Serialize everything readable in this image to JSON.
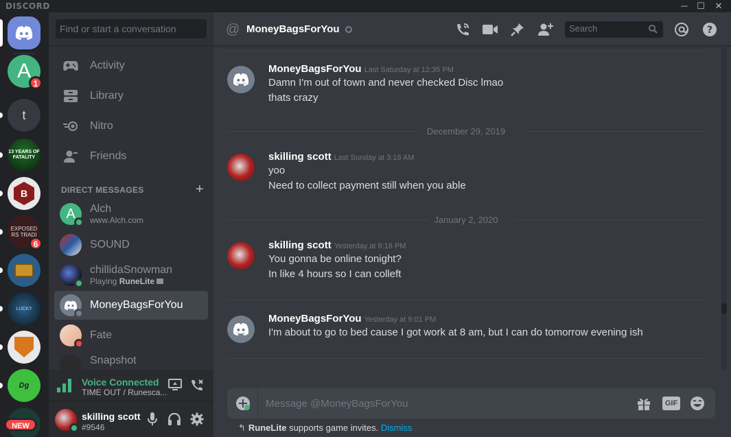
{
  "app": {
    "brand": "DISCORD"
  },
  "window": {
    "minimize": "─",
    "maximize": "☐",
    "close": "✕"
  },
  "servers": [
    {
      "name": "discord-home",
      "letter": ""
    },
    {
      "name": "A",
      "letter": "A",
      "badge": "1"
    },
    {
      "name": "t",
      "letter": "t"
    },
    {
      "name": "13 YEARS OF FATALITY",
      "letter": "13 YEARS OF FATALITY"
    },
    {
      "name": "B",
      "letter": "B"
    },
    {
      "name": "EXPOSED RS TRADI",
      "letter": "EXPOSED RS TRADI",
      "badge": "6"
    },
    {
      "name": "chest",
      "letter": ""
    },
    {
      "name": "LUCKY",
      "letter": "LUCKY"
    },
    {
      "name": "shield",
      "letter": ""
    },
    {
      "name": "DrinkGameClub",
      "letter": ""
    },
    {
      "name": "NEW",
      "letter": "",
      "badge": "NEW"
    }
  ],
  "sidebar": {
    "search_placeholder": "Find or start a conversation",
    "nav": [
      {
        "label": "Activity",
        "icon": "gamepad-icon"
      },
      {
        "label": "Library",
        "icon": "library-icon"
      },
      {
        "label": "Nitro",
        "icon": "nitro-icon"
      },
      {
        "label": "Friends",
        "icon": "friends-icon"
      }
    ],
    "dm_header": "DIRECT MESSAGES",
    "dm_add": "+",
    "dms": [
      {
        "name": "Alch",
        "sub": "www.Alch.com",
        "status": "online"
      },
      {
        "name": "SOUND",
        "sub": "",
        "status": "none"
      },
      {
        "name": "chillidaSnowman",
        "sub_prefix": "Playing ",
        "sub_bold": "RuneLite",
        "status": "online"
      },
      {
        "name": "MoneyBagsForYou",
        "sub": "",
        "status": "offline",
        "active": true
      },
      {
        "name": "Fate",
        "sub": "",
        "status": "dnd"
      },
      {
        "name": "Snapshot",
        "sub": "",
        "status": "none"
      }
    ],
    "voice": {
      "title": "Voice Connected",
      "channel": "TIME OUT / Runesca..."
    },
    "user": {
      "name": "skilling scott",
      "tag": "#9546"
    }
  },
  "header": {
    "channel": "MoneyBagsForYou",
    "search_placeholder": "Search"
  },
  "messages": [
    {
      "author": "MoneyBagsForYou",
      "time": "Last Saturday at 12:35 PM",
      "lines": [
        "Damn I'm out of town and never checked Disc lmao",
        "thats crazy"
      ],
      "avatar": "discord"
    },
    {
      "date": "December 29, 2019"
    },
    {
      "author": "skilling scott",
      "time": "Last Sunday at 3:18 AM",
      "lines": [
        "yoo",
        "Need to collect payment still when you able"
      ],
      "avatar": "red"
    },
    {
      "date": "January 2, 2020"
    },
    {
      "author": "skilling scott",
      "time": "Yesterday at 8:16 PM",
      "lines": [
        "You gonna be online tonight?",
        "In like 4 hours so I can colleft"
      ],
      "avatar": "red"
    },
    {
      "author": "MoneyBagsForYou",
      "time": "Yesterday at 9:01 PM",
      "lines": [
        "I'm about to go to bed cause I got work at 8 am, but I can do tomorrow evening ish"
      ],
      "avatar": "discord"
    }
  ],
  "composer": {
    "placeholder": "Message @MoneyBagsForYou",
    "gif": "GIF"
  },
  "notice": {
    "prefix_bold": "RuneLite",
    "text": " supports game invites.",
    "dismiss": "Dismiss"
  },
  "colors": {
    "blurple": "#7289da",
    "online": "#43b581",
    "dnd": "#f04747",
    "offline": "#747f8d",
    "link": "#00b0f4"
  }
}
